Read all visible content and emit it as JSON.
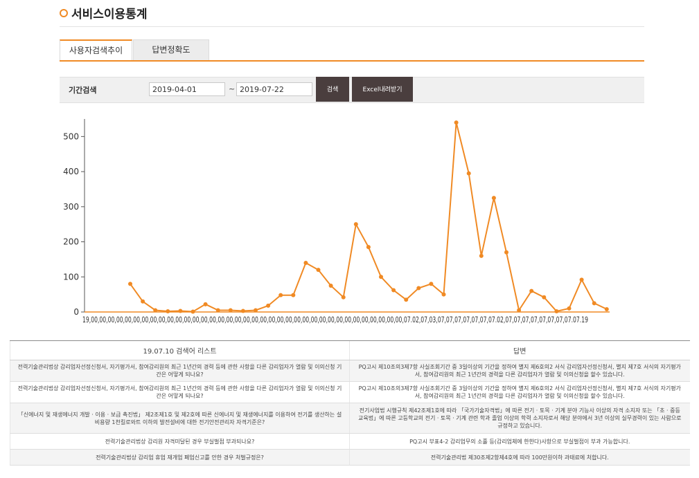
{
  "page": {
    "title": "서비스이용통계"
  },
  "tabs": [
    {
      "label": "사용자검색추이",
      "active": true
    },
    {
      "label": "답변정확도",
      "active": false
    }
  ],
  "search": {
    "label": "기간검색",
    "start_date": "2019-04-01",
    "separator": "~",
    "end_date": "2019-07-22",
    "search_button": "검색",
    "excel_button": "Excel내려받기"
  },
  "chart_data": {
    "type": "line",
    "title": "",
    "xlabel": "",
    "ylabel": "",
    "color": "#f08a24",
    "ylim": [
      0,
      550
    ],
    "yticks": [
      0,
      100,
      200,
      300,
      400,
      500
    ],
    "x_tick_label_text": "19,00,00,00,00,00,00,00,00,00,00,00,00,00,00,00,00,00,00,00,00,00,00,00,00,00,00,00,00,00,00,00,00,00,00,00,00,00,07.02,07,03,07,07,07,07,07,07,07.02,07,07,07,07,07,07,07,07.07.19",
    "values": [
      80,
      30,
      5,
      2,
      3,
      1,
      22,
      5,
      5,
      3,
      5,
      18,
      48,
      48,
      140,
      120,
      75,
      42,
      250,
      185,
      100,
      62,
      35,
      68,
      80,
      50,
      540,
      395,
      160,
      325,
      170,
      5,
      60,
      42,
      2,
      10,
      92,
      25,
      8
    ]
  },
  "table": {
    "headers": [
      "19.07.10 검색어 리스트",
      "답변"
    ],
    "rows": [
      [
        "전력기술관리법상 감리업자선정신청서, 자기평가서, 참여감리원의 최근 1년간의 경력 등에 관한 사항을 다른 감리업자가 열람 및 이의신청 기간은 어떻게 되나요?",
        "PQ고시 제10조의3제7항 사실조회기간 중 3일이상의 기간을 정하여 별지 제6호의2 서식 감리업자선정신청서, 별지 제7호 서식의 자기평가서, 참여감리원의 최근 1년간의 경력을 다른 감리업자가 열람 및 이의신청을 할수 있습니다."
      ],
      [
        "전력기술관리법상 감리업자선정신청서, 자기평가서, 참여감리원의 최근 1년간의 경력 등에 관한 사항을 다른 감리업자가 열람 및 이의신청 기간은 어떻게 되나요?",
        "PQ고시 제10조의3제7항 사실조회기간 중 3일이상의 기간을 정하여 별지 제6호의2 서식 감리업자선정신청서, 별지 제7호 서식의 자기평가서, 참여감리원의 최근 1년간의 경력을 다른 감리업자가 열람 및 이의신청을 할수 있습니다."
      ],
      [
        "「신에너지 및 재생에너지 개발 · 이용 · 보급 촉진법」 제2조제1호 및 제2호에 따른 신에너지 및 재생에너지를 이용하여 전기를 생산하는 설비용량 1천킬로와트 이하의 발전설비에 대한 전기안전관리자 자격기준은?",
        "전기사업법 시행규칙 제42조제1호에 따라 「국가기술자격법」에 따른 전기 · 토목 · 기계 분야 기능사 이상의 자격 소지자 또는 「초 · 중등교육법」에 따른 고등학교의 전기 · 토목 · 기계 관련 학과 졸업 이상의 학력 소지자로서 해당 분야에서 3년 이상의 실무경력이 있는 사람으로 규정하고 있습니다."
      ],
      [
        "전력기술관리법상 감리원 자격미달된 경우 부실벌점 부과되나요?",
        "PQ고시 부표4-2 감리업무의 소홀 등(감리업체에 한한다)사항으로 부실벌점이 부과 가능합니다."
      ],
      [
        "전력기술관리법상 감리업 휴업 재개업 폐업신고를 안한 경우 처벌규정은?",
        "전력기술관리법 제30조제2항제4호에 따라 100만원이하 과태료에 처합니다."
      ]
    ]
  }
}
